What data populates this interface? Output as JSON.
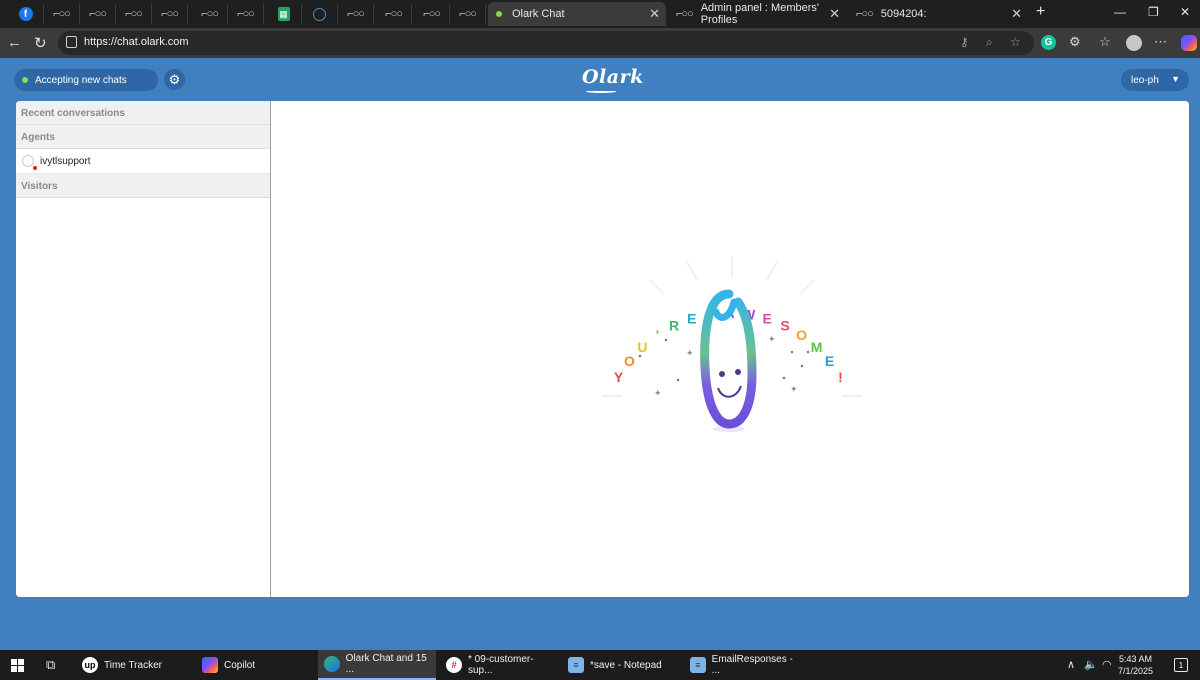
{
  "browser": {
    "tabs": [
      {
        "label": "Olark Chat",
        "active": true
      },
      {
        "label": "Admin panel : Members' Profiles",
        "active": false
      },
      {
        "label": "5094204:",
        "active": false
      }
    ],
    "url": "https://chat.olark.com",
    "close_glyph": "✕",
    "new_tab_glyph": "+"
  },
  "app": {
    "status_label": "Accepting new chats",
    "logo_text": "Olark",
    "user_label": "leo-ph",
    "sidebar": {
      "recent_label": "Recent conversations",
      "agents_label": "Agents",
      "agents": [
        {
          "name": "ivytlsupport",
          "status_color": "#e02020"
        }
      ],
      "visitors_label": "Visitors"
    },
    "empty_state": {
      "banner_text": "YOU'RE AWESOME!",
      "letter_colors": [
        "#e84a4a",
        "#f08a2a",
        "#e7c12b",
        "#8bc34a",
        "#3fb86a",
        "#29a9c6",
        "#3f7fe0",
        "#6b5ee0",
        "#9b4fd6",
        "#d24fb0",
        "#e84a6a",
        "#f0a02a",
        "#5fc04a",
        "#2a9ed8",
        "#e84a4a"
      ]
    },
    "brand_color": "#4080c0"
  },
  "taskbar": {
    "items": [
      {
        "label": "Time Tracker",
        "icon": "upwork-icon"
      },
      {
        "label": "Copilot",
        "icon": "copilot-icon"
      },
      {
        "label": "Olark Chat and 15 ...",
        "icon": "edge-icon",
        "active": true
      },
      {
        "label": "* 09-customer-sup...",
        "icon": "slack-icon"
      },
      {
        "label": "*save - Notepad",
        "icon": "notepad-icon"
      },
      {
        "label": "EmailResponses - ...",
        "icon": "notepad-icon"
      }
    ],
    "time": "5:43 AM",
    "date": "7/1/2025",
    "notification_count": "1"
  }
}
